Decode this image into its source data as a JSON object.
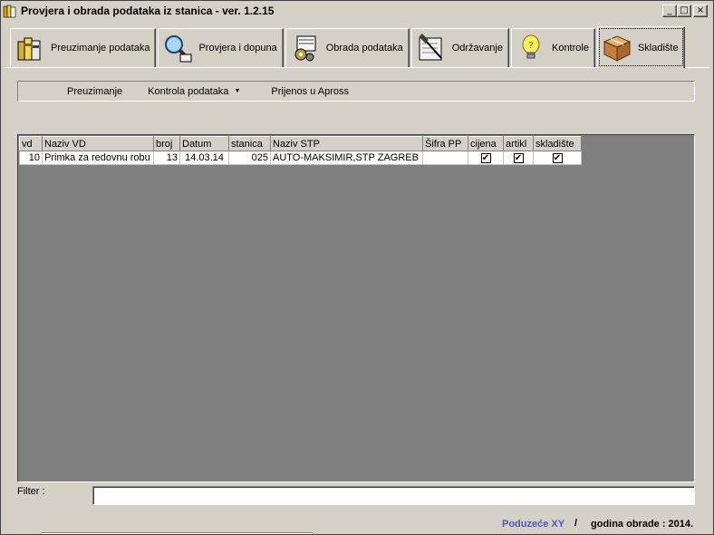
{
  "window": {
    "title": "Provjera i obrada podataka iz stanica - ver. 1.2.15",
    "buttons": {
      "minimize": "_",
      "maximize": "□",
      "close": "×"
    }
  },
  "tabs": [
    {
      "label": "Preuzimanje podataka",
      "icon": "books-icon"
    },
    {
      "label": "Provjera i dopuna",
      "icon": "magnifier-icon"
    },
    {
      "label": "Obrada podataka",
      "icon": "gears-icon"
    },
    {
      "label": "Održavanje",
      "icon": "hammer-icon"
    },
    {
      "label": "Kontrole",
      "icon": "lightbulb-icon"
    },
    {
      "label": "Skladište",
      "icon": "box-icon",
      "active": true
    }
  ],
  "menu": {
    "items": [
      {
        "label": "Preuzimanje"
      },
      {
        "label": "Kontrola podataka",
        "dropdown": true,
        "arrow": "▼"
      },
      {
        "label": "Prijenos u Apross"
      }
    ]
  },
  "grid": {
    "columns": [
      "vd",
      "Naziv VD",
      "broj",
      "Datum",
      "stanica",
      "Naziv STP",
      "Šifra PP",
      "cijena",
      "artikl",
      "skladište"
    ],
    "rows": [
      {
        "vd": "10",
        "naziv_vd": "Primka za redovnu robu",
        "broj": "13",
        "datum": "14.03.14",
        "stanica": "025",
        "naziv_stp": "AUTO-MAKSIMIR,STP ZAGREB",
        "sifra_pp": "",
        "cijena": true,
        "artikl": true,
        "skladiste": true,
        "check": "✔"
      }
    ]
  },
  "filter": {
    "label": "Filter :",
    "value": ""
  },
  "status": {
    "company": "Poduzeće XY",
    "separator": "/",
    "year_text": "godina obrade : 2014."
  },
  "colors": {
    "window_bg": "#d4d0c8",
    "grid_bg": "#808080",
    "company": "#4a5cb8"
  }
}
